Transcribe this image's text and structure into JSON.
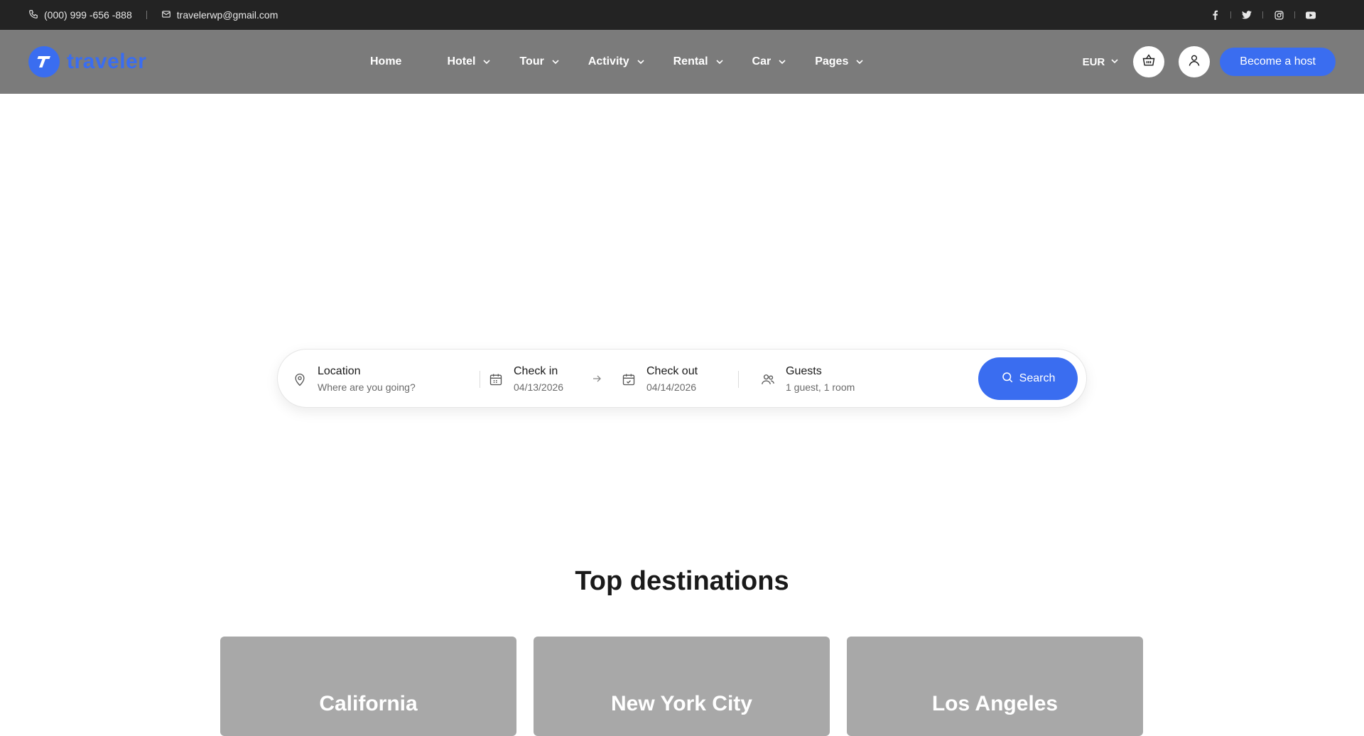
{
  "topbar": {
    "phone": "(000) 999 -656 -888",
    "email": "travelerwp@gmail.com",
    "socials": [
      "facebook-icon",
      "twitter-icon",
      "instagram-icon",
      "youtube-icon"
    ]
  },
  "header": {
    "logo_text": "traveler",
    "nav": [
      {
        "label": "Home",
        "dropdown": false
      },
      {
        "label": "Hotel",
        "dropdown": true
      },
      {
        "label": "Tour",
        "dropdown": true
      },
      {
        "label": "Activity",
        "dropdown": true
      },
      {
        "label": "Rental",
        "dropdown": true
      },
      {
        "label": "Car",
        "dropdown": true
      },
      {
        "label": "Pages",
        "dropdown": true
      }
    ],
    "currency": "EUR",
    "cart_icon": "basket-icon",
    "account_icon": "user-icon",
    "host_button": "Become a host"
  },
  "search": {
    "location": {
      "title": "Location",
      "placeholder": "Where are you going?"
    },
    "checkin": {
      "title": "Check in",
      "value": "04/13/2026"
    },
    "checkout": {
      "title": "Check out",
      "value": "04/14/2026"
    },
    "guests": {
      "title": "Guests",
      "value": "1 guest, 1 room"
    },
    "button": "Search"
  },
  "destinations": {
    "title": "Top destinations",
    "cards": [
      "California",
      "New York City",
      "Los Angeles"
    ]
  },
  "colors": {
    "accent": "#3a6df0",
    "topbar_bg": "#232323",
    "header_bg": "#7b7b7b",
    "card_bg": "#a8a8a8"
  }
}
